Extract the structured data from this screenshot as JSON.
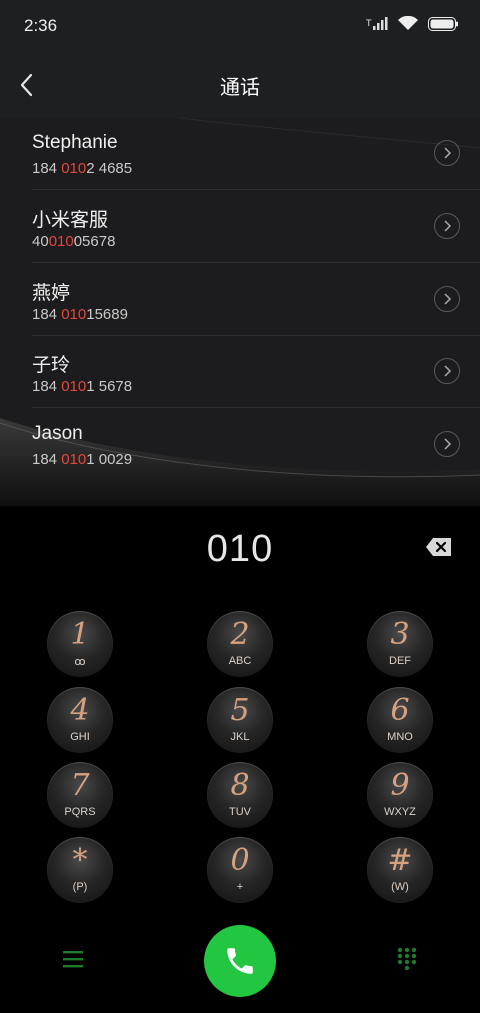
{
  "status_bar": {
    "time": "2:36"
  },
  "header": {
    "title": "通话"
  },
  "contacts": [
    {
      "name": "Stephanie",
      "number_pre": "184 ",
      "number_hl": "010",
      "number_post": "2 4685"
    },
    {
      "name": "小米客服",
      "number_pre": "40",
      "number_hl": "010",
      "number_post": "05678"
    },
    {
      "name": "燕婷",
      "number_pre": "184 ",
      "number_hl": "010",
      "number_post": "15689"
    },
    {
      "name": "子玲",
      "number_pre": "184 ",
      "number_hl": "010",
      "number_post": "1 5678"
    },
    {
      "name": "Jason",
      "number_pre": "184 ",
      "number_hl": "010",
      "number_post": "1 0029"
    }
  ],
  "dial": {
    "number": "010"
  },
  "keys": [
    {
      "digit": "1",
      "letters": "ꝏ"
    },
    {
      "digit": "2",
      "letters": "ABC"
    },
    {
      "digit": "3",
      "letters": "DEF"
    },
    {
      "digit": "4",
      "letters": "GHI"
    },
    {
      "digit": "5",
      "letters": "JKL"
    },
    {
      "digit": "6",
      "letters": "MNO"
    },
    {
      "digit": "7",
      "letters": "PQRS"
    },
    {
      "digit": "8",
      "letters": "TUV"
    },
    {
      "digit": "9",
      "letters": "WXYZ"
    },
    {
      "digit": "*",
      "letters": "(P)"
    },
    {
      "digit": "0",
      "letters": "+"
    },
    {
      "digit": "#",
      "letters": "(W)"
    }
  ],
  "icons": {
    "back": "chevron-left-icon",
    "backspace": "backspace-icon",
    "call": "phone-icon",
    "menu": "menu-icon",
    "keypad": "keypad-icon"
  },
  "colors": {
    "highlight": "#e8463b",
    "call_button": "#23c640",
    "digit": "#d7a17f",
    "bottom_icons": "#1f7a2c"
  }
}
